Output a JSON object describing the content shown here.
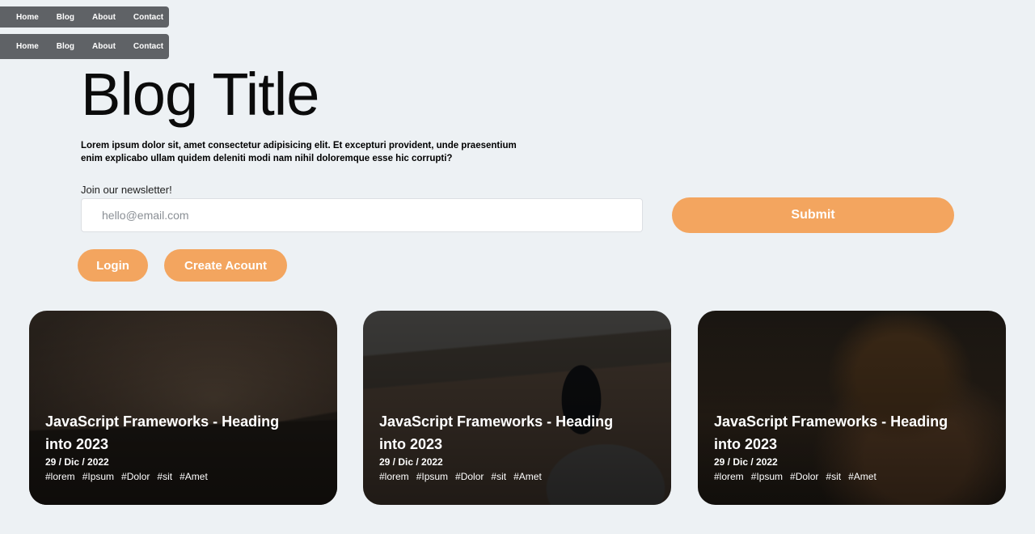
{
  "nav": [
    "Home",
    "Blog",
    "About",
    "Contact"
  ],
  "blog_title": "Blog Title",
  "intro": "Lorem ipsum dolor sit, amet consectetur adipisicing elit. Et excepturi provident, unde praesentium enim explicabo ullam quidem deleniti modi nam nihil doloremque esse hic corrupti?",
  "newsletter": {
    "label": "Join our newsletter!",
    "placeholder": "hello@email.com",
    "submit": "Submit"
  },
  "auth": {
    "login": "Login",
    "create": "Create Acount"
  },
  "colors": {
    "accent": "#f3a55f",
    "navbar": "#5f6266",
    "background": "#edf1f4"
  },
  "cards": [
    {
      "title": "JavaScript Frameworks - Heading into 2023",
      "date": "29 / Dic / 2022",
      "tags": [
        "#lorem",
        "#Ipsum",
        "#Dolor",
        "#sit",
        "#Amet"
      ]
    },
    {
      "title": "JavaScript Frameworks - Heading into 2023",
      "date": "29 / Dic / 2022",
      "tags": [
        "#lorem",
        "#Ipsum",
        "#Dolor",
        "#sit",
        "#Amet"
      ]
    },
    {
      "title": "JavaScript Frameworks - Heading into 2023",
      "date": "29 / Dic / 2022",
      "tags": [
        "#lorem",
        "#Ipsum",
        "#Dolor",
        "#sit",
        "#Amet"
      ]
    }
  ]
}
